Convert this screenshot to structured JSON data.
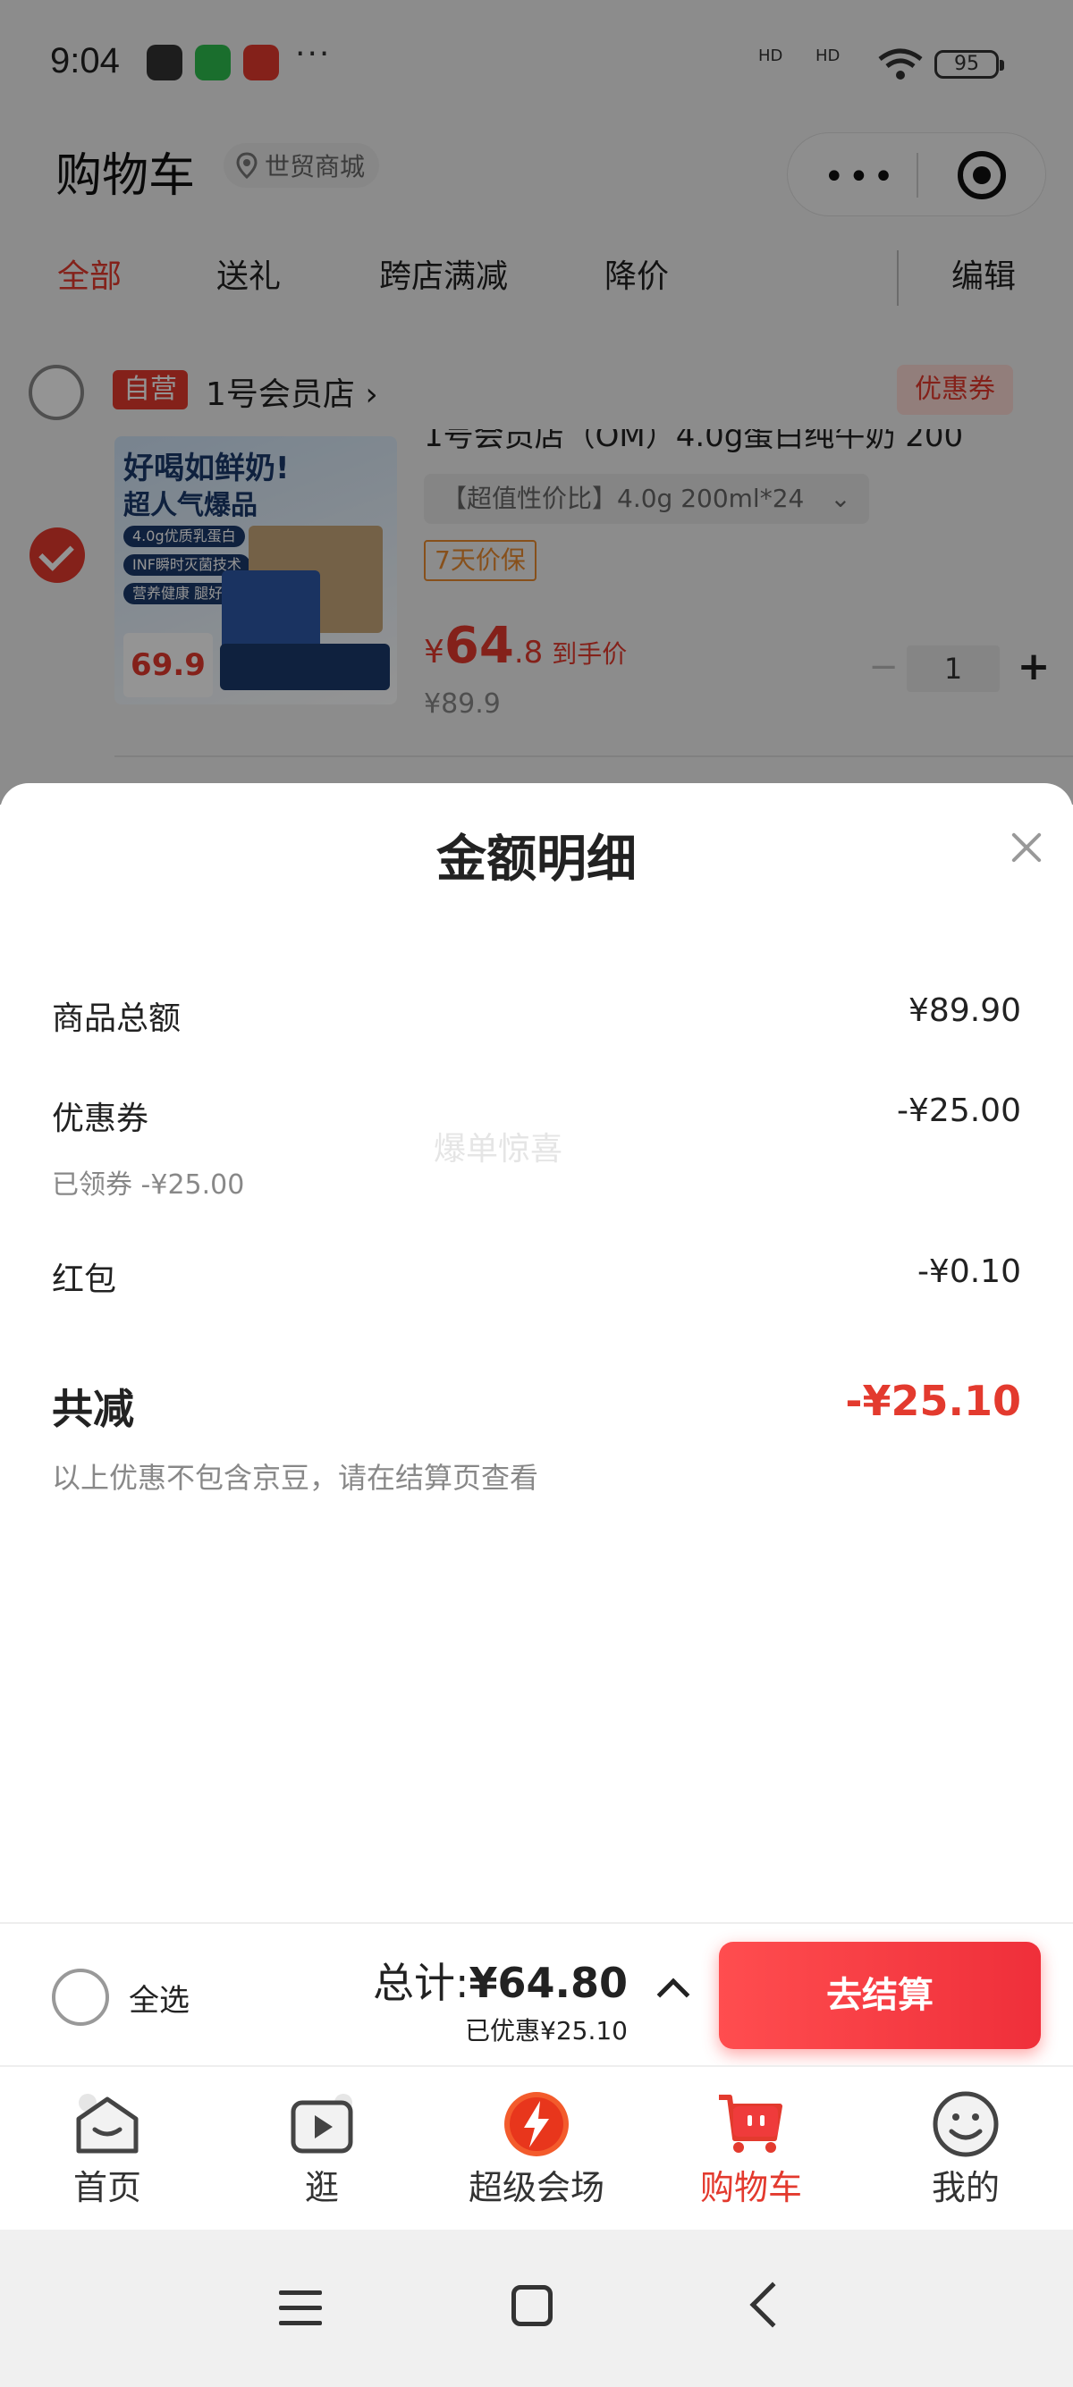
{
  "status_bar": {
    "time": "9:04",
    "more": "···",
    "signal_1": "HD",
    "signal_2": "HD",
    "battery": "95"
  },
  "header": {
    "title": "购物车",
    "location": "世贸商城"
  },
  "filter_tabs": [
    {
      "label": "全部"
    },
    {
      "label": "送礼"
    },
    {
      "label": "跨店满减"
    },
    {
      "label": "降价"
    }
  ],
  "edit_label": "编辑",
  "store": {
    "tag": "自营",
    "name": "1号会员店 ›",
    "coupon_label": "优惠券"
  },
  "product": {
    "title": "1号会员店（OM）4.0g蛋白纯牛奶 200",
    "spec": "【超值性价比】4.0g 200ml*24",
    "guarantee": "7天价保",
    "price_symbol": "¥",
    "price_int": "64",
    "price_dec": ".8",
    "price_label": "到手价",
    "original_price": "¥89.9",
    "quantity": "1",
    "image_text": {
      "line1": "好喝如鲜奶!",
      "line2": "超人气爆品",
      "chip1": "4.0g优质乳蛋白",
      "chip2": "INF瞬时灭菌技术",
      "chip3": "营养健康 腿好睡眠",
      "price": "69.9"
    }
  },
  "modal": {
    "title": "金额明细",
    "goods_total_label": "商品总额",
    "goods_total_value": "¥89.90",
    "coupon_label": "优惠券",
    "coupon_value": "-¥25.00",
    "coupon_sub": "已领券 -¥25.00",
    "watermark": "爆单惊喜",
    "red_packet_label": "红包",
    "red_packet_value": "-¥0.10",
    "total_discount_label": "共减",
    "total_discount_value": "-¥25.10",
    "note": "以上优惠不包含京豆，请在结算页查看"
  },
  "checkout": {
    "select_all": "全选",
    "total_prefix": "总计:",
    "total_value": "¥64.80",
    "saved": "已优惠¥25.10",
    "button": "去结算"
  },
  "tab_bar": [
    {
      "label": "首页",
      "icon": "home-icon"
    },
    {
      "label": "逛",
      "icon": "play-video-icon"
    },
    {
      "label": "超级会场",
      "icon": "super-venue-icon"
    },
    {
      "label": "购物车",
      "icon": "shopping-cart-icon",
      "active": true
    },
    {
      "label": "我的",
      "icon": "smiley-profile-icon"
    }
  ],
  "colors": {
    "accent": "#e33a2e",
    "button": "#ff4d4f",
    "orange_tag": "#e88a2f"
  }
}
